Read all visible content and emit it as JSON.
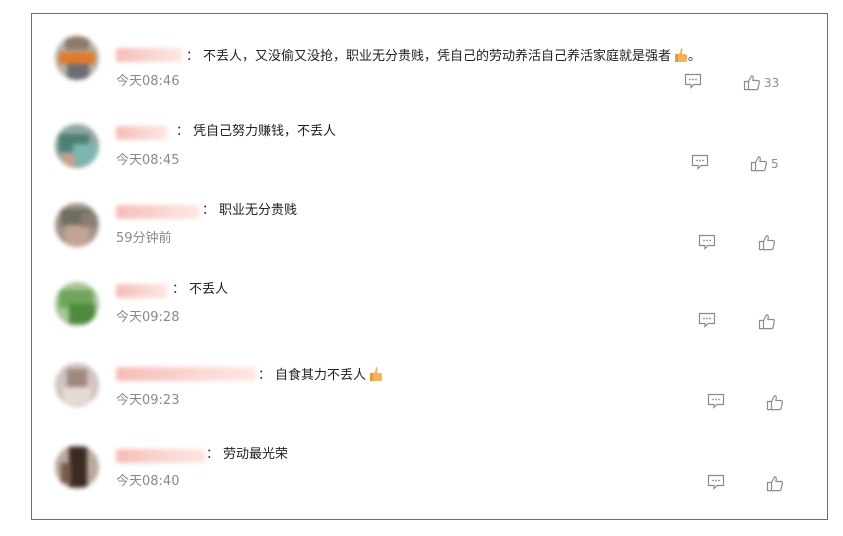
{
  "comments": [
    {
      "text": "不丢人，又没偷又没抢，职业无分贵贱，凭自己的劳动养活自己养活家庭就是强者",
      "has_emoji": true,
      "trailing": "。",
      "time": "今天08:46",
      "likes": "33"
    },
    {
      "text": "凭自己努力赚钱，不丢人",
      "has_emoji": false,
      "trailing": "",
      "time": "今天08:45",
      "likes": "5"
    },
    {
      "text": "职业无分贵贱",
      "has_emoji": false,
      "trailing": "",
      "time": "59分钟前",
      "likes": ""
    },
    {
      "text": "不丢人",
      "has_emoji": false,
      "trailing": "",
      "time": "今天09:28",
      "likes": ""
    },
    {
      "text": "自食其力不丢人",
      "has_emoji": true,
      "trailing": "",
      "time": "今天09:23",
      "likes": ""
    },
    {
      "text": "劳动最光荣",
      "has_emoji": false,
      "trailing": "",
      "time": "今天08:40",
      "likes": ""
    }
  ],
  "colon": "：",
  "icons": {
    "reply": "comment-icon",
    "like": "thumbs-up-icon",
    "emoji": "thumbs-up-emoji"
  },
  "colors": {
    "text": "#222222",
    "meta": "#8a8a8a",
    "icon": "#8c8c8c",
    "border": "#6f6f6f",
    "name_blur": "#f6b9b4"
  }
}
